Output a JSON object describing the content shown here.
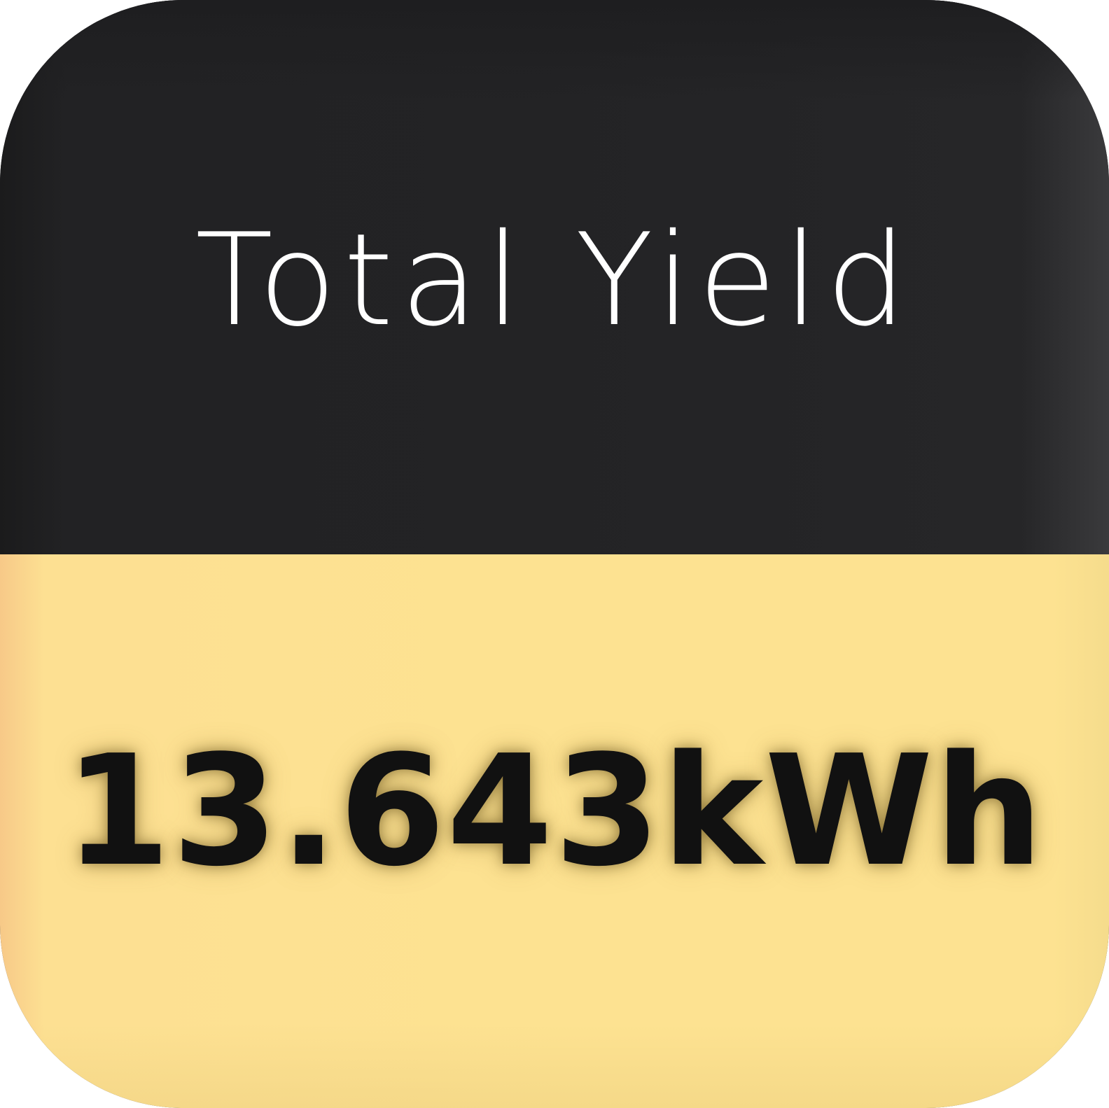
{
  "tile": {
    "title": "Total Yield",
    "value": "13.643kWh"
  },
  "colors": {
    "header_background": "#222224",
    "body_background": "#fde291",
    "title_text": "#ffffff",
    "value_text": "#111111"
  }
}
